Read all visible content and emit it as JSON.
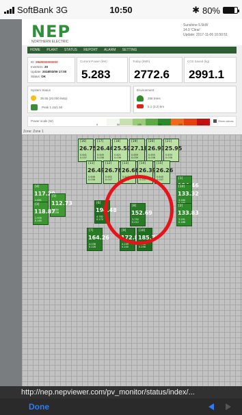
{
  "status_bar": {
    "carrier": "SoftBank",
    "network": "3G",
    "time": "10:50",
    "battery": "80%",
    "battery_level": 0.8
  },
  "header": {
    "logo": "NEP",
    "subtitle": "NORTHERN ELECTRIC",
    "weather": [
      "Sunshine 5.5kW",
      "14.0 'Clear'",
      "Update: 2017-11-06 10:50:51"
    ]
  },
  "nav": {
    "items": [
      "HOME",
      "PLANT",
      "STATUS",
      "REPORT",
      "ALARM",
      "SETTING"
    ]
  },
  "stats": {
    "info": [
      {
        "key": "ID:",
        "value": "2840000000000"
      },
      {
        "key": "Inverters:",
        "value": "20"
      },
      {
        "key": "Update:",
        "value": "2018/03/09 17:00"
      },
      {
        "key": "Status:",
        "value": "OK"
      }
    ],
    "boxes": [
      {
        "caption": "Current Power (kW)",
        "value": "5.283",
        "color": "#e01818"
      },
      {
        "caption": "Today (kWh)",
        "value": "2772.6",
        "color": "#d08a10"
      },
      {
        "caption": "CO2 Saved (kg)",
        "value": "2991.1",
        "color": "#2a9a2a"
      }
    ]
  },
  "details": {
    "left": {
      "caption": "System Status",
      "lines": [
        "36.55 (20.000 kWp)",
        "Peak 1.24/1.50"
      ]
    },
    "right": {
      "caption": "Environment",
      "lines": [
        "258 trees",
        "5.1 (3.2) km"
      ]
    }
  },
  "legend": {
    "label": "Power scale (W)",
    "ticks": [
      "0",
      "50",
      "100",
      "150",
      "200",
      "250"
    ],
    "option_label": "Show values",
    "colors": [
      "#ffffff",
      "#f4f8ef",
      "#c8dfb0",
      "#9bcc77",
      "#5daa44",
      "#2c8a2c",
      "#ee6a1c",
      "#e53f10",
      "#c31010"
    ]
  },
  "zone_label": "Zone: Zone 1",
  "panels": [
    {
      "id": "[16]",
      "power": "26.75",
      "sub": [
        "0.641",
        "0.037"
      ],
      "color": "#b6dda0"
    },
    {
      "id": "[17]",
      "power": "26.44",
      "sub": [
        "0.649",
        "0.038"
      ],
      "color": "#b6dda0"
    },
    {
      "id": "[18]",
      "power": "25.50",
      "sub": [
        "0.621",
        "0.036"
      ],
      "color": "#bde2a6"
    },
    {
      "id": "[19]",
      "power": "27.18",
      "sub": [
        "0.659",
        "0.039"
      ],
      "color": "#b0d99a"
    },
    {
      "id": "[20]",
      "power": "26.93",
      "sub": [
        "0.655",
        "0.038"
      ],
      "color": "#b6dda0"
    },
    {
      "id": "[21]",
      "power": "25.95",
      "sub": [
        "0.633",
        "0.036"
      ],
      "color": "#bde2a6"
    },
    {
      "id": "[11]",
      "power": "26.49",
      "sub": [
        "0.646",
        "0.038"
      ],
      "color": "#b6dda0"
    },
    {
      "id": "[12]",
      "power": "26.76",
      "sub": [
        "0.652",
        "0.037"
      ],
      "color": "#b6dda0"
    },
    {
      "id": "[13]",
      "power": "26.66",
      "sub": [
        "0.647",
        "0.038"
      ],
      "color": "#b6dda0"
    },
    {
      "id": "[14]",
      "power": "26.39",
      "sub": [
        "0.642",
        "0.037"
      ],
      "color": "#b6dda0"
    },
    {
      "id": "[15]",
      "power": "26.26",
      "sub": [
        "0.640",
        "0.037"
      ],
      "color": "#b6dda0"
    },
    {
      "id": "[4]",
      "power": "117.20",
      "sub": [
        "2.891",
        "0.163"
      ],
      "color": "#3f9a33"
    },
    {
      "id": "[5]",
      "power": "112.73",
      "sub": [
        "2.780",
        "0.158"
      ],
      "color": "#3f9a33"
    },
    {
      "id": "[3]",
      "power": "118.87",
      "sub": [
        "2.930",
        "0.165"
      ],
      "color": "#3b9630"
    },
    {
      "id": "[1]",
      "power": "134.46",
      "sub": [
        "3.302",
        "0.187"
      ],
      "color": "#2f8a2a"
    },
    {
      "id": "[10]",
      "power": "133.32",
      "sub": [
        "3.280",
        "0.185"
      ],
      "color": "#2f8a2a"
    },
    {
      "id": "[2]",
      "power": "133.83",
      "sub": [
        "3.291",
        "0.186"
      ],
      "color": "#2f8a2a"
    },
    {
      "id": "[6]",
      "power": "194.48",
      "sub": [
        "4.782",
        "0.270"
      ],
      "color": "#1f6e1f"
    },
    {
      "id": "[7]",
      "power": "164.26",
      "sub": [
        "4.038",
        "0.228"
      ],
      "color": "#287a26"
    },
    {
      "id": "[8]",
      "power": "152.69",
      "sub": [
        "3.752",
        "0.212"
      ],
      "color": "#287a26"
    },
    {
      "id": "[9]",
      "power": "172.86",
      "sub": [
        "4.249",
        "0.240"
      ],
      "color": "#237323"
    },
    {
      "id": "[10]",
      "power": "185.79",
      "sub": [
        "4.568",
        "0.258"
      ],
      "color": "#1f6e1f"
    }
  ],
  "url": "http://nep.nepviewer.com/pv_monitor/status/index/...",
  "toolbar": {
    "done_label": "Done"
  }
}
